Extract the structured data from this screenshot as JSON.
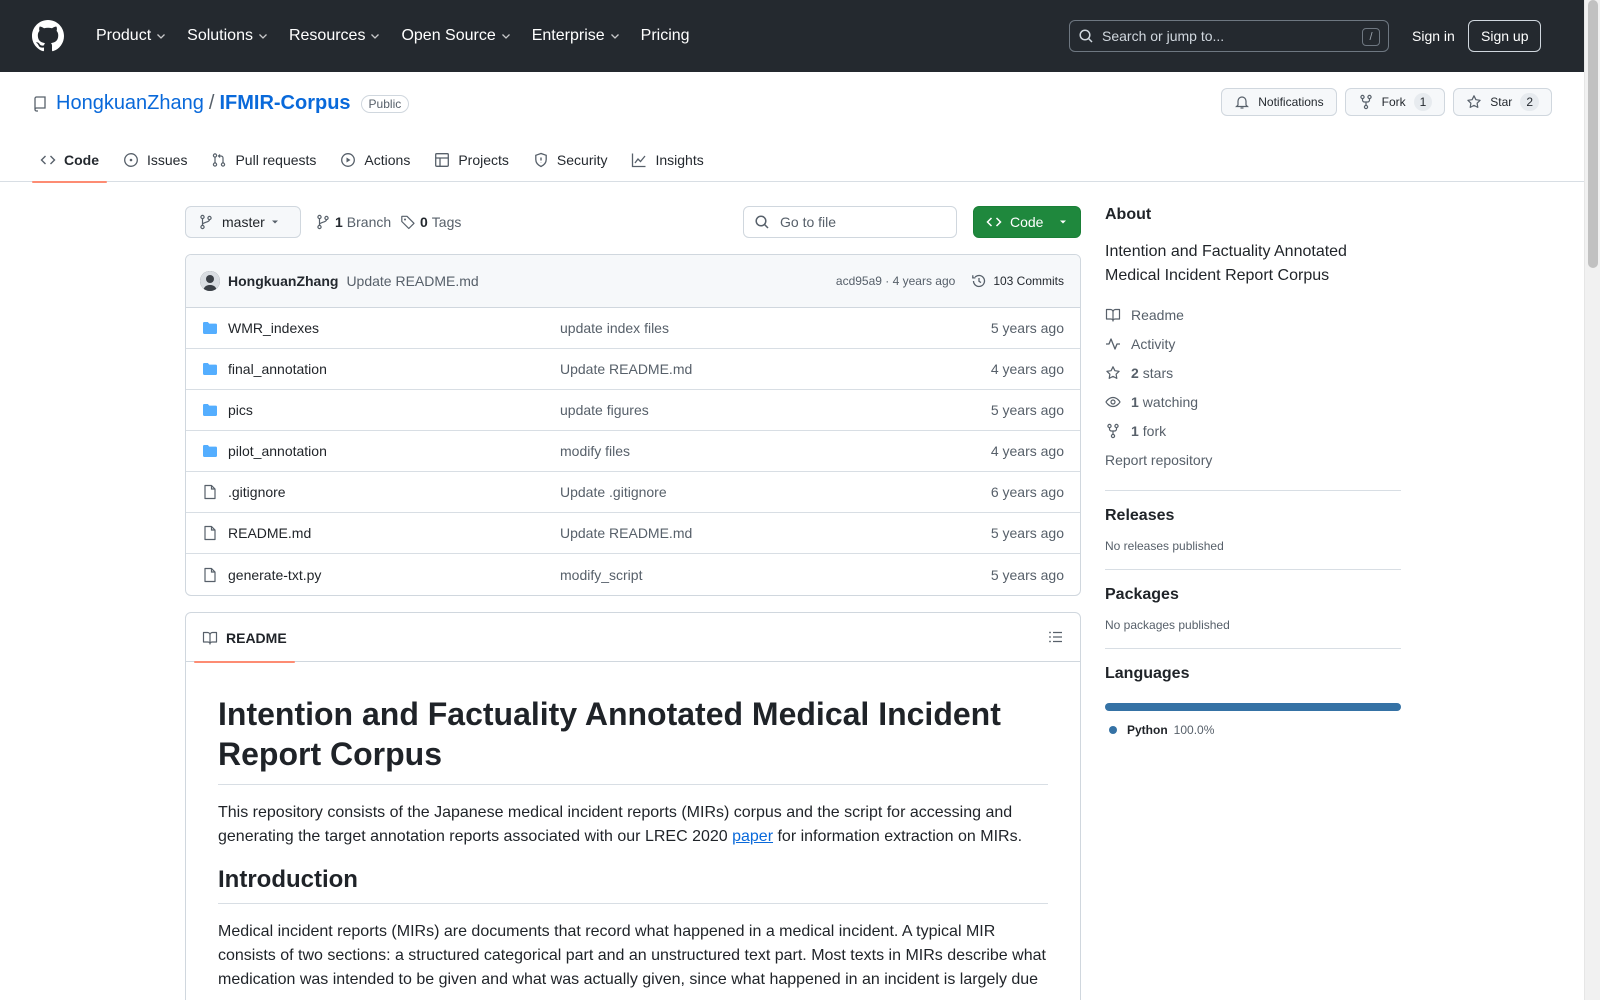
{
  "header": {
    "nav": [
      {
        "label": "Product",
        "has_menu": true
      },
      {
        "label": "Solutions",
        "has_menu": true
      },
      {
        "label": "Resources",
        "has_menu": true
      },
      {
        "label": "Open Source",
        "has_menu": true
      },
      {
        "label": "Enterprise",
        "has_menu": true
      },
      {
        "label": "Pricing",
        "has_menu": false
      }
    ],
    "search_placeholder": "Search or jump to...",
    "search_shortcut": "/",
    "signin_label": "Sign in",
    "signup_label": "Sign up"
  },
  "repo": {
    "owner": "HongkuanZhang",
    "separator": "/",
    "name": "IFMIR-Corpus",
    "visibility": "Public",
    "actions": {
      "notifications_label": "Notifications",
      "fork_label": "Fork",
      "fork_count": "1",
      "star_label": "Star",
      "star_count": "2"
    },
    "tabs": [
      {
        "label": "Code",
        "icon": "code-icon",
        "active": true
      },
      {
        "label": "Issues",
        "icon": "issue-icon",
        "active": false
      },
      {
        "label": "Pull requests",
        "icon": "pull-request-icon",
        "active": false
      },
      {
        "label": "Actions",
        "icon": "play-icon",
        "active": false
      },
      {
        "label": "Projects",
        "icon": "table-icon",
        "active": false
      },
      {
        "label": "Security",
        "icon": "shield-icon",
        "active": false
      },
      {
        "label": "Insights",
        "icon": "graph-icon",
        "active": false
      }
    ]
  },
  "toolbar": {
    "branch": "master",
    "branch_count": "1",
    "branch_label": "Branch",
    "tag_count": "0",
    "tag_label": "Tags",
    "goto_placeholder": "Go to file",
    "code_label": "Code"
  },
  "latest_commit": {
    "author": "HongkuanZhang",
    "message": "Update README.md",
    "hash_age": "acd95a9 · 4 years ago",
    "commits_label": "103 Commits"
  },
  "files": [
    {
      "type": "dir",
      "name": "WMR_indexes",
      "message": "update index files",
      "age": "5 years ago"
    },
    {
      "type": "dir",
      "name": "final_annotation",
      "message": "Update README.md",
      "age": "4 years ago"
    },
    {
      "type": "dir",
      "name": "pics",
      "message": "update figures",
      "age": "5 years ago"
    },
    {
      "type": "dir",
      "name": "pilot_annotation",
      "message": "modify files",
      "age": "4 years ago"
    },
    {
      "type": "file",
      "name": ".gitignore",
      "message": "Update .gitignore",
      "age": "6 years ago"
    },
    {
      "type": "file",
      "name": "README.md",
      "message": "Update README.md",
      "age": "5 years ago"
    },
    {
      "type": "file",
      "name": "generate-txt.py",
      "message": "modify_script",
      "age": "5 years ago"
    }
  ],
  "readme": {
    "tab_label": "README",
    "title": "Intention and Factuality Annotated Medical Incident Report Corpus",
    "intro_before_link": "This repository consists of the Japanese medical incident reports (MIRs) corpus and the script for accessing and generating the target annotation reports associated with our LREC 2020 ",
    "intro_link": "paper",
    "intro_after_link": " for information extraction on MIRs.",
    "section_heading": "Introduction",
    "section_text": "Medical incident reports (MIRs) are documents that record what happened in a medical incident. A typical MIR consists of two sections: a structured categorical part and an unstructured text part. Most texts in MIRs describe what medication was intended to be given and what was actually given, since what happened in an incident is largely due"
  },
  "sidebar": {
    "about_heading": "About",
    "description": "Intention and Factuality Annotated Medical Incident Report Corpus",
    "readme_label": "Readme",
    "activity_label": "Activity",
    "stars_count": "2",
    "stars_label": "stars",
    "watching_count": "1",
    "watching_label": "watching",
    "forks_count": "1",
    "forks_label": "fork",
    "report_label": "Report repository",
    "releases_heading": "Releases",
    "releases_text": "No releases published",
    "packages_heading": "Packages",
    "packages_text": "No packages published",
    "languages_heading": "Languages",
    "language": {
      "name": "Python",
      "percent": "100.0%",
      "fraction": 1.0,
      "color": "#3572a5"
    }
  },
  "colors": {
    "header_bg": "#24292f",
    "link": "#0969da",
    "code_button": "#1f883d",
    "folder": "#54aeff",
    "tab_underline": "#fd8c73"
  }
}
